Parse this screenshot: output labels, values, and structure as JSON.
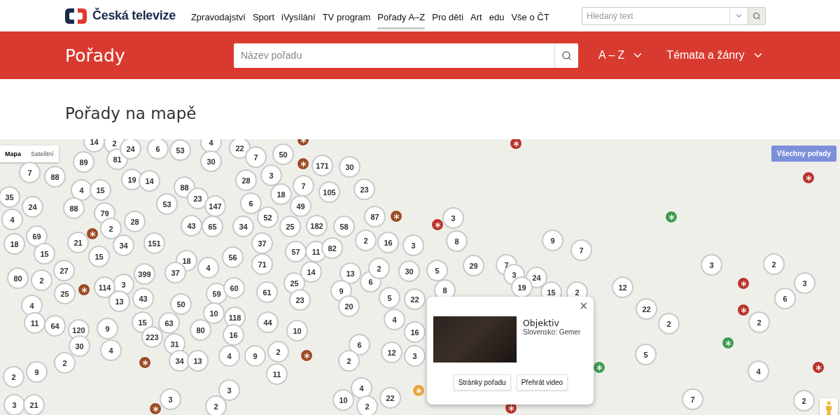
{
  "header": {
    "logo": "Česká televize",
    "nav": [
      {
        "label": "Zpravodajství",
        "selected": false
      },
      {
        "label": "Sport",
        "selected": false
      },
      {
        "label": "iVysílání",
        "selected": false
      },
      {
        "label": "TV program",
        "selected": false
      },
      {
        "label": "Pořady A–Z",
        "selected": true
      },
      {
        "label": "Pro děti",
        "selected": false
      },
      {
        "label": "Art",
        "selected": false
      },
      {
        "label": "edu",
        "selected": false
      },
      {
        "label": "Vše o ČT",
        "selected": false
      }
    ],
    "search": {
      "placeholder": "Hledaný text"
    }
  },
  "banner": {
    "title": "Pořady",
    "search": {
      "placeholder": "Název pořadu"
    },
    "menus": [
      "A – Z",
      "Témata a žánry"
    ]
  },
  "heading": "Pořady na mapě",
  "map": {
    "types": [
      {
        "label": "Mapa",
        "selected": true
      },
      {
        "label": "Satelitní",
        "selected": false
      }
    ],
    "all_button": "Všechny pořady",
    "markers": [
      {
        "kind": "cluster",
        "count": "14"
      },
      {
        "kind": "cluster",
        "count": "2"
      },
      {
        "kind": "cluster",
        "count": "81"
      },
      {
        "kind": "cluster",
        "count": "24"
      },
      {
        "kind": "cluster",
        "count": "6"
      },
      {
        "kind": "cluster",
        "count": "53"
      },
      {
        "kind": "cluster",
        "count": "4"
      },
      {
        "kind": "cluster",
        "count": "22"
      },
      {
        "kind": "cluster",
        "count": "7"
      },
      {
        "kind": "cluster",
        "count": "50"
      },
      {
        "kind": "pin",
        "color": "#9b4a25"
      },
      {
        "kind": "pin",
        "color": "#b8332a"
      },
      {
        "kind": "cluster",
        "count": "7"
      },
      {
        "kind": "cluster",
        "count": "88"
      },
      {
        "kind": "cluster",
        "count": "89"
      },
      {
        "kind": "cluster",
        "count": "19"
      },
      {
        "kind": "cluster",
        "count": "14"
      },
      {
        "kind": "cluster",
        "count": "30"
      },
      {
        "kind": "cluster",
        "count": "28"
      },
      {
        "kind": "cluster",
        "count": "3"
      },
      {
        "kind": "pin",
        "color": "#9b4a25"
      },
      {
        "kind": "cluster",
        "count": "171"
      },
      {
        "kind": "cluster",
        "count": "30"
      },
      {
        "kind": "pin",
        "color": "#b8332a"
      },
      {
        "kind": "cluster",
        "count": "35"
      },
      {
        "kind": "cluster",
        "count": "4"
      },
      {
        "kind": "cluster",
        "count": "15"
      },
      {
        "kind": "cluster",
        "count": "88"
      },
      {
        "kind": "cluster",
        "count": "23"
      },
      {
        "kind": "cluster",
        "count": "18"
      },
      {
        "kind": "cluster",
        "count": "7"
      },
      {
        "kind": "cluster",
        "count": "105"
      },
      {
        "kind": "cluster",
        "count": "23"
      },
      {
        "kind": "cluster",
        "count": "4"
      },
      {
        "kind": "cluster",
        "count": "24"
      },
      {
        "kind": "cluster",
        "count": "88"
      },
      {
        "kind": "cluster",
        "count": "79"
      },
      {
        "kind": "cluster",
        "count": "28"
      },
      {
        "kind": "cluster",
        "count": "53"
      },
      {
        "kind": "cluster",
        "count": "147"
      },
      {
        "kind": "cluster",
        "count": "6"
      },
      {
        "kind": "cluster",
        "count": "52"
      },
      {
        "kind": "cluster",
        "count": "49"
      },
      {
        "kind": "cluster",
        "count": "87"
      },
      {
        "kind": "pin",
        "color": "#9b4a25"
      },
      {
        "kind": "cluster",
        "count": "3"
      },
      {
        "kind": "pin",
        "color": "#3f9a4f"
      },
      {
        "kind": "cluster",
        "count": "69"
      },
      {
        "kind": "pin",
        "color": "#9b4a25"
      },
      {
        "kind": "cluster",
        "count": "2"
      },
      {
        "kind": "cluster",
        "count": "43"
      },
      {
        "kind": "cluster",
        "count": "65"
      },
      {
        "kind": "cluster",
        "count": "34"
      },
      {
        "kind": "cluster",
        "count": "25"
      },
      {
        "kind": "cluster",
        "count": "182"
      },
      {
        "kind": "cluster",
        "count": "58"
      },
      {
        "kind": "pin",
        "color": "#b8332a"
      },
      {
        "kind": "cluster",
        "count": "18"
      },
      {
        "kind": "cluster",
        "count": "15"
      },
      {
        "kind": "cluster",
        "count": "21"
      },
      {
        "kind": "cluster",
        "count": "15"
      },
      {
        "kind": "cluster",
        "count": "34"
      },
      {
        "kind": "cluster",
        "count": "151"
      },
      {
        "kind": "cluster",
        "count": "18"
      },
      {
        "kind": "cluster",
        "count": "56"
      },
      {
        "kind": "cluster",
        "count": "37"
      },
      {
        "kind": "cluster",
        "count": "71"
      },
      {
        "kind": "cluster",
        "count": "57"
      },
      {
        "kind": "cluster",
        "count": "11"
      },
      {
        "kind": "cluster",
        "count": "82"
      },
      {
        "kind": "cluster",
        "count": "2"
      },
      {
        "kind": "cluster",
        "count": "16"
      },
      {
        "kind": "cluster",
        "count": "3"
      },
      {
        "kind": "cluster",
        "count": "8"
      },
      {
        "kind": "cluster",
        "count": "7"
      },
      {
        "kind": "cluster",
        "count": "9"
      },
      {
        "kind": "cluster",
        "count": "7"
      },
      {
        "kind": "cluster",
        "count": "80"
      },
      {
        "kind": "cluster",
        "count": "2"
      },
      {
        "kind": "cluster",
        "count": "27"
      },
      {
        "kind": "cluster",
        "count": "3"
      },
      {
        "kind": "cluster",
        "count": "399"
      },
      {
        "kind": "cluster",
        "count": "37"
      },
      {
        "kind": "cluster",
        "count": "4"
      },
      {
        "kind": "cluster",
        "count": "25"
      },
      {
        "kind": "cluster",
        "count": "14"
      },
      {
        "kind": "cluster",
        "count": "13"
      },
      {
        "kind": "cluster",
        "count": "6"
      },
      {
        "kind": "cluster",
        "count": "2"
      },
      {
        "kind": "cluster",
        "count": "30"
      },
      {
        "kind": "cluster",
        "count": "5"
      },
      {
        "kind": "cluster",
        "count": "29"
      },
      {
        "kind": "cluster",
        "count": "3"
      },
      {
        "kind": "cluster",
        "count": "24"
      },
      {
        "kind": "cluster",
        "count": "3"
      },
      {
        "kind": "pin",
        "color": "#b8332a"
      },
      {
        "kind": "cluster",
        "count": "2"
      },
      {
        "kind": "cluster",
        "count": "3"
      },
      {
        "kind": "cluster",
        "count": "4"
      },
      {
        "kind": "cluster",
        "count": "25"
      },
      {
        "kind": "pin",
        "color": "#9b4a25"
      },
      {
        "kind": "cluster",
        "count": "114"
      },
      {
        "kind": "cluster",
        "count": "13"
      },
      {
        "kind": "cluster",
        "count": "43"
      },
      {
        "kind": "cluster",
        "count": "50"
      },
      {
        "kind": "cluster",
        "count": "59"
      },
      {
        "kind": "cluster",
        "count": "60"
      },
      {
        "kind": "cluster",
        "count": "61"
      },
      {
        "kind": "cluster",
        "count": "23"
      },
      {
        "kind": "cluster",
        "count": "9"
      },
      {
        "kind": "cluster",
        "count": "20"
      },
      {
        "kind": "cluster",
        "count": "5"
      },
      {
        "kind": "cluster",
        "count": "22"
      },
      {
        "kind": "cluster",
        "count": "8"
      },
      {
        "kind": "cluster",
        "count": "19"
      },
      {
        "kind": "cluster",
        "count": "15"
      },
      {
        "kind": "cluster",
        "count": "2"
      },
      {
        "kind": "cluster",
        "count": "12"
      },
      {
        "kind": "cluster",
        "count": "6"
      },
      {
        "kind": "cluster",
        "count": "11"
      },
      {
        "kind": "cluster",
        "count": "64"
      },
      {
        "kind": "cluster",
        "count": "120"
      },
      {
        "kind": "cluster",
        "count": "15"
      },
      {
        "kind": "cluster",
        "count": "63"
      },
      {
        "kind": "cluster",
        "count": "10"
      },
      {
        "kind": "cluster",
        "count": "118"
      },
      {
        "kind": "cluster",
        "count": "44"
      },
      {
        "kind": "cluster",
        "count": "4"
      },
      {
        "kind": "cluster",
        "count": "22"
      },
      {
        "kind": "cluster",
        "count": "2"
      },
      {
        "kind": "pin",
        "color": "#b8332a"
      },
      {
        "kind": "cluster",
        "count": "2"
      },
      {
        "kind": "cluster",
        "count": "30"
      },
      {
        "kind": "cluster",
        "count": "9"
      },
      {
        "kind": "cluster",
        "count": "223"
      },
      {
        "kind": "cluster",
        "count": "31"
      },
      {
        "kind": "cluster",
        "count": "80"
      },
      {
        "kind": "cluster",
        "count": "16"
      },
      {
        "kind": "cluster",
        "count": "10"
      },
      {
        "kind": "cluster",
        "count": "6"
      },
      {
        "kind": "cluster",
        "count": "16"
      },
      {
        "kind": "pin",
        "color": "#3f9a4f"
      },
      {
        "kind": "cluster",
        "count": "2"
      },
      {
        "kind": "cluster",
        "count": "4"
      },
      {
        "kind": "pin",
        "color": "#9b4a25"
      },
      {
        "kind": "cluster",
        "count": "34"
      },
      {
        "kind": "cluster",
        "count": "13"
      },
      {
        "kind": "cluster",
        "count": "4"
      },
      {
        "kind": "cluster",
        "count": "9"
      },
      {
        "kind": "cluster",
        "count": "2"
      },
      {
        "kind": "pin",
        "color": "#9b4a25"
      },
      {
        "kind": "cluster",
        "count": "2"
      },
      {
        "kind": "cluster",
        "count": "12"
      },
      {
        "kind": "cluster",
        "count": "3"
      },
      {
        "kind": "pin",
        "color": "#3f9a4f"
      },
      {
        "kind": "cluster",
        "count": "5"
      },
      {
        "kind": "cluster",
        "count": "2"
      },
      {
        "kind": "cluster",
        "count": "9"
      },
      {
        "kind": "cluster",
        "count": "3"
      },
      {
        "kind": "cluster",
        "count": "11"
      },
      {
        "kind": "cluster",
        "count": "4"
      },
      {
        "kind": "pin",
        "color": "#eaa23a"
      },
      {
        "kind": "cluster",
        "count": "4"
      },
      {
        "kind": "pin",
        "color": "#b8332a"
      },
      {
        "kind": "cluster",
        "count": "3"
      },
      {
        "kind": "cluster",
        "count": "21"
      },
      {
        "kind": "pin",
        "color": "#9b4a25"
      },
      {
        "kind": "cluster",
        "count": "3"
      },
      {
        "kind": "cluster",
        "count": "2"
      },
      {
        "kind": "cluster",
        "count": "10"
      },
      {
        "kind": "cluster",
        "count": "2"
      },
      {
        "kind": "cluster",
        "count": "22"
      },
      {
        "kind": "pin",
        "color": "#b8332a"
      },
      {
        "kind": "cluster",
        "count": "7"
      },
      {
        "kind": "cluster",
        "count": "2"
      }
    ],
    "popup": {
      "close": "×",
      "title": "Objektiv",
      "subtitle": "Slovensko: Gemer",
      "buttons": [
        "Stránky pořadu",
        "Přehrát video"
      ]
    }
  }
}
